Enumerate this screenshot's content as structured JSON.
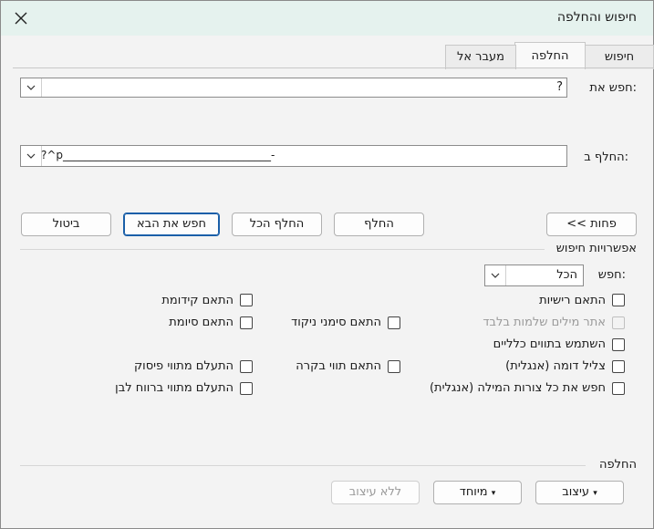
{
  "window": {
    "title": "חיפוש והחלפה"
  },
  "tabs": [
    {
      "label": "חיפוש"
    },
    {
      "label": "החלפה"
    },
    {
      "label": "מעבר אל"
    }
  ],
  "find": {
    "label": "חפש את:",
    "value": "?"
  },
  "replace": {
    "label": "החלף ב:",
    "value": "?^p______________________________________-"
  },
  "buttons": {
    "less": "<< פחות",
    "replace": "החלף",
    "replace_all": "החלף הכל",
    "find_next": "חפש את הבא",
    "cancel": "ביטול"
  },
  "options": {
    "title": "אפשרויות חיפוש",
    "search_label": "חפש:",
    "search_value": "הכל",
    "match_case": "התאם רישיות",
    "whole_words": "אתר מילים שלמות בלבד",
    "wildcards": "השתמש בתווים כלליים",
    "sounds_like": "צליל דומה (אנגלית)",
    "all_forms": "חפש את כל צורות המילה (אנגלית)",
    "match_prefix": "התאם קידומת",
    "match_suffix": "התאם סיומת",
    "match_diacritics": "התאם סימני ניקוד",
    "match_kashida": "התאם תווי בקרה",
    "ignore_punct": "התעלם מתווי פיסוק",
    "ignore_space": "התעלם מתווי ברווח לבן"
  },
  "replace_section": {
    "title": "החלפה",
    "format": "עיצוב",
    "special": "מיוחד",
    "no_format": "ללא עיצוב"
  }
}
